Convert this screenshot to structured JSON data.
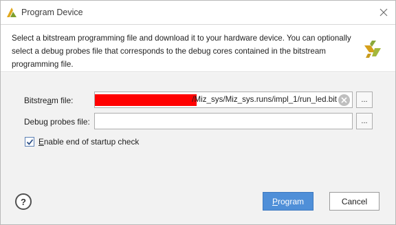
{
  "window": {
    "title": "Program Device"
  },
  "description": {
    "text": "Select a bitstream programming file and download it to your hardware device. You can optionally select a debug probes file that corresponds to the debug cores contained in the bitstream programming file."
  },
  "form": {
    "bitstream_label_pre": "Bitstre",
    "bitstream_label_u": "a",
    "bitstream_label_post": "m file:",
    "bitstream_value": "/Miz_sys/Miz_sys.runs/impl_1/run_led.bit",
    "debug_label_pre": "Debu",
    "debug_label_u": "g",
    "debug_label_post": " probes file:",
    "debug_value": "",
    "browse_label": "...",
    "startup_check_u": "E",
    "startup_check_post": "nable end of startup check",
    "startup_check_checked": true
  },
  "buttons": {
    "help_label": "?",
    "program_u": "P",
    "program_post": "rogram",
    "cancel_label": "Cancel"
  },
  "colors": {
    "primary": "#4f8fd8",
    "redaction": "#ff0000",
    "logo": "#d6a01a"
  }
}
